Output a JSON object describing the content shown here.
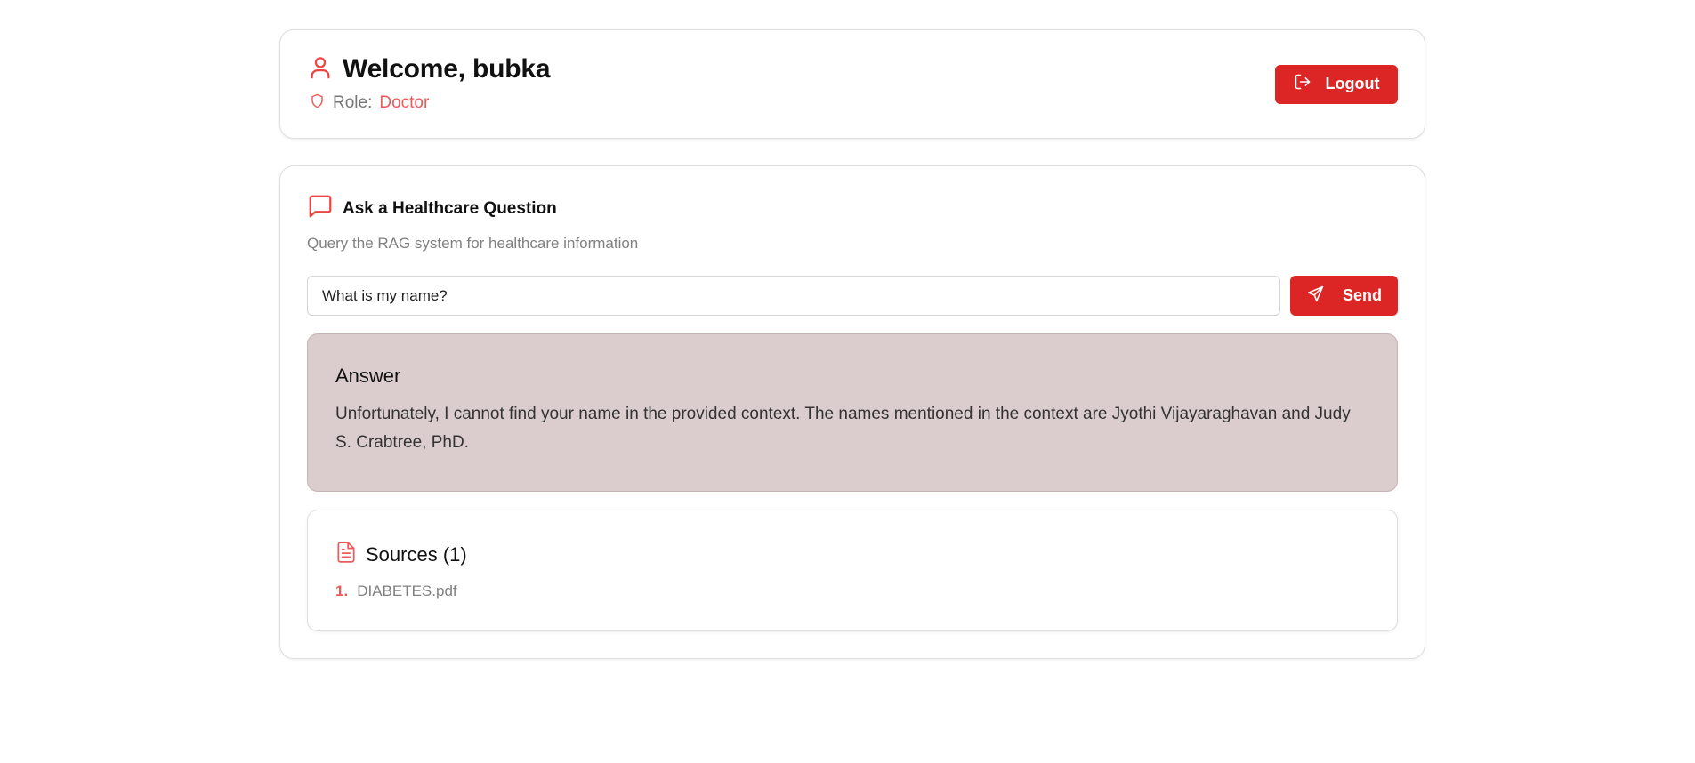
{
  "header": {
    "welcome": "Welcome, bubka",
    "role_label": "Role:",
    "role_value": "Doctor",
    "logout_label": "Logout",
    "icons": {
      "user": "user-icon",
      "role": "shield-icon",
      "logout": "logout-icon"
    }
  },
  "ask": {
    "title": "Ask a Healthcare Question",
    "subtitle": "Query the RAG system for healthcare information",
    "input_value": "What is my name?",
    "send_label": "Send",
    "icons": {
      "title": "message-square-icon",
      "send": "send-icon"
    }
  },
  "answer": {
    "title": "Answer",
    "text": "Unfortunately, I cannot find your name in the provided context. The names mentioned in the context are Jyothi Vijayaraghavan and Judy S. Crabtree, PhD."
  },
  "sources": {
    "title": "Sources (1)",
    "icon": "file-text-icon",
    "items": [
      {
        "num": "1.",
        "name": "DIABETES.pdf"
      }
    ]
  },
  "colors": {
    "accent": "#dc2626",
    "accent_light": "#ee5a5a",
    "answer_bg": "#dbcdcd"
  }
}
